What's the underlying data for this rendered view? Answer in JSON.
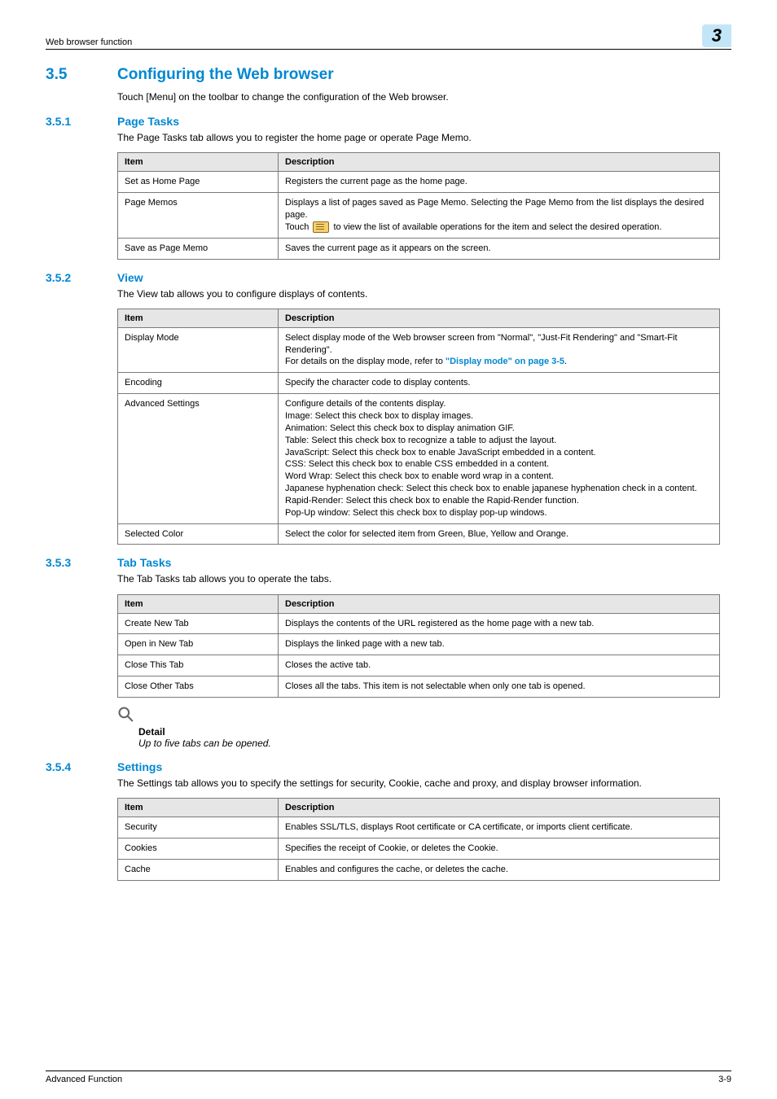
{
  "running_header": "Web browser function",
  "chapter_number": "3",
  "sections": {
    "s35": {
      "num": "3.5",
      "title": "Configuring the Web browser",
      "intro": "Touch [Menu] on the toolbar to change the configuration of the Web browser."
    },
    "s351": {
      "num": "3.5.1",
      "title": "Page Tasks",
      "intro": "The Page Tasks tab allows you to register the home page or operate Page Memo."
    },
    "s352": {
      "num": "3.5.2",
      "title": "View",
      "intro": "The View tab allows you to configure displays of contents."
    },
    "s353": {
      "num": "3.5.3",
      "title": "Tab Tasks",
      "intro": "The Tab Tasks tab allows you to operate the tabs."
    },
    "s354": {
      "num": "3.5.4",
      "title": "Settings",
      "intro": "The Settings tab allows you to specify the settings for security, Cookie, cache and proxy, and display browser information."
    }
  },
  "table_headers": {
    "item": "Item",
    "desc": "Description"
  },
  "table_page_tasks": [
    {
      "item": "Set as Home Page",
      "desc": "Registers the current page as the home page."
    },
    {
      "item": "Page Memos",
      "desc_pre": "Displays a list of pages saved as Page Memo. Selecting the Page Memo from the list displays the desired page.\nTouch ",
      "desc_post": " to view the list of available operations for the item and select the desired operation.",
      "has_icon": true
    },
    {
      "item": "Save as Page Memo",
      "desc": "Saves the current page as it appears on the screen."
    }
  ],
  "table_view": [
    {
      "item": "Display Mode",
      "desc_pre": "Select display mode of the Web browser screen from \"Normal\", \"Just-Fit Rendering\" and \"Smart-Fit Rendering\".\nFor details on the display mode, refer to ",
      "link": "\"Display mode\" on page 3-5",
      "desc_post": "."
    },
    {
      "item": "Encoding",
      "desc": "Specify the character code to display contents."
    },
    {
      "item": "Advanced Settings",
      "desc": "Configure details of the contents display.\nImage: Select this check box to display images.\nAnimation: Select this check box to display animation GIF.\nTable: Select this check box to recognize a table to adjust the layout.\nJavaScript: Select this check box to enable JavaScript embedded in a content.\nCSS: Select this check box to enable CSS embedded in a content.\nWord Wrap: Select this check box to enable word wrap in a content.\nJapanese hyphenation check: Select this check box to enable japanese hyphenation check in a content.\nRapid-Render: Select this check box to enable the Rapid-Render function.\nPop-Up window: Select this check box to display pop-up windows."
    },
    {
      "item": "Selected Color",
      "desc": "Select the color for selected item from Green, Blue, Yellow and Orange."
    }
  ],
  "table_tab_tasks": [
    {
      "item": "Create New Tab",
      "desc": "Displays the contents of the URL registered as the home page with a new tab."
    },
    {
      "item": "Open in New Tab",
      "desc": "Displays the linked page with a new tab."
    },
    {
      "item": "Close This Tab",
      "desc": "Closes the active tab."
    },
    {
      "item": "Close Other Tabs",
      "desc": "Closes all the tabs. This item is not selectable when only one tab is opened."
    }
  ],
  "table_settings": [
    {
      "item": "Security",
      "desc": "Enables SSL/TLS, displays Root certificate or CA certificate, or imports client certificate."
    },
    {
      "item": "Cookies",
      "desc": "Specifies the receipt of Cookie, or deletes the Cookie."
    },
    {
      "item": "Cache",
      "desc": "Enables and configures the cache, or deletes the cache."
    }
  ],
  "detail": {
    "label": "Detail",
    "body": "Up to five tabs can be opened."
  },
  "footer": {
    "left": "Advanced Function",
    "right": "3-9"
  }
}
